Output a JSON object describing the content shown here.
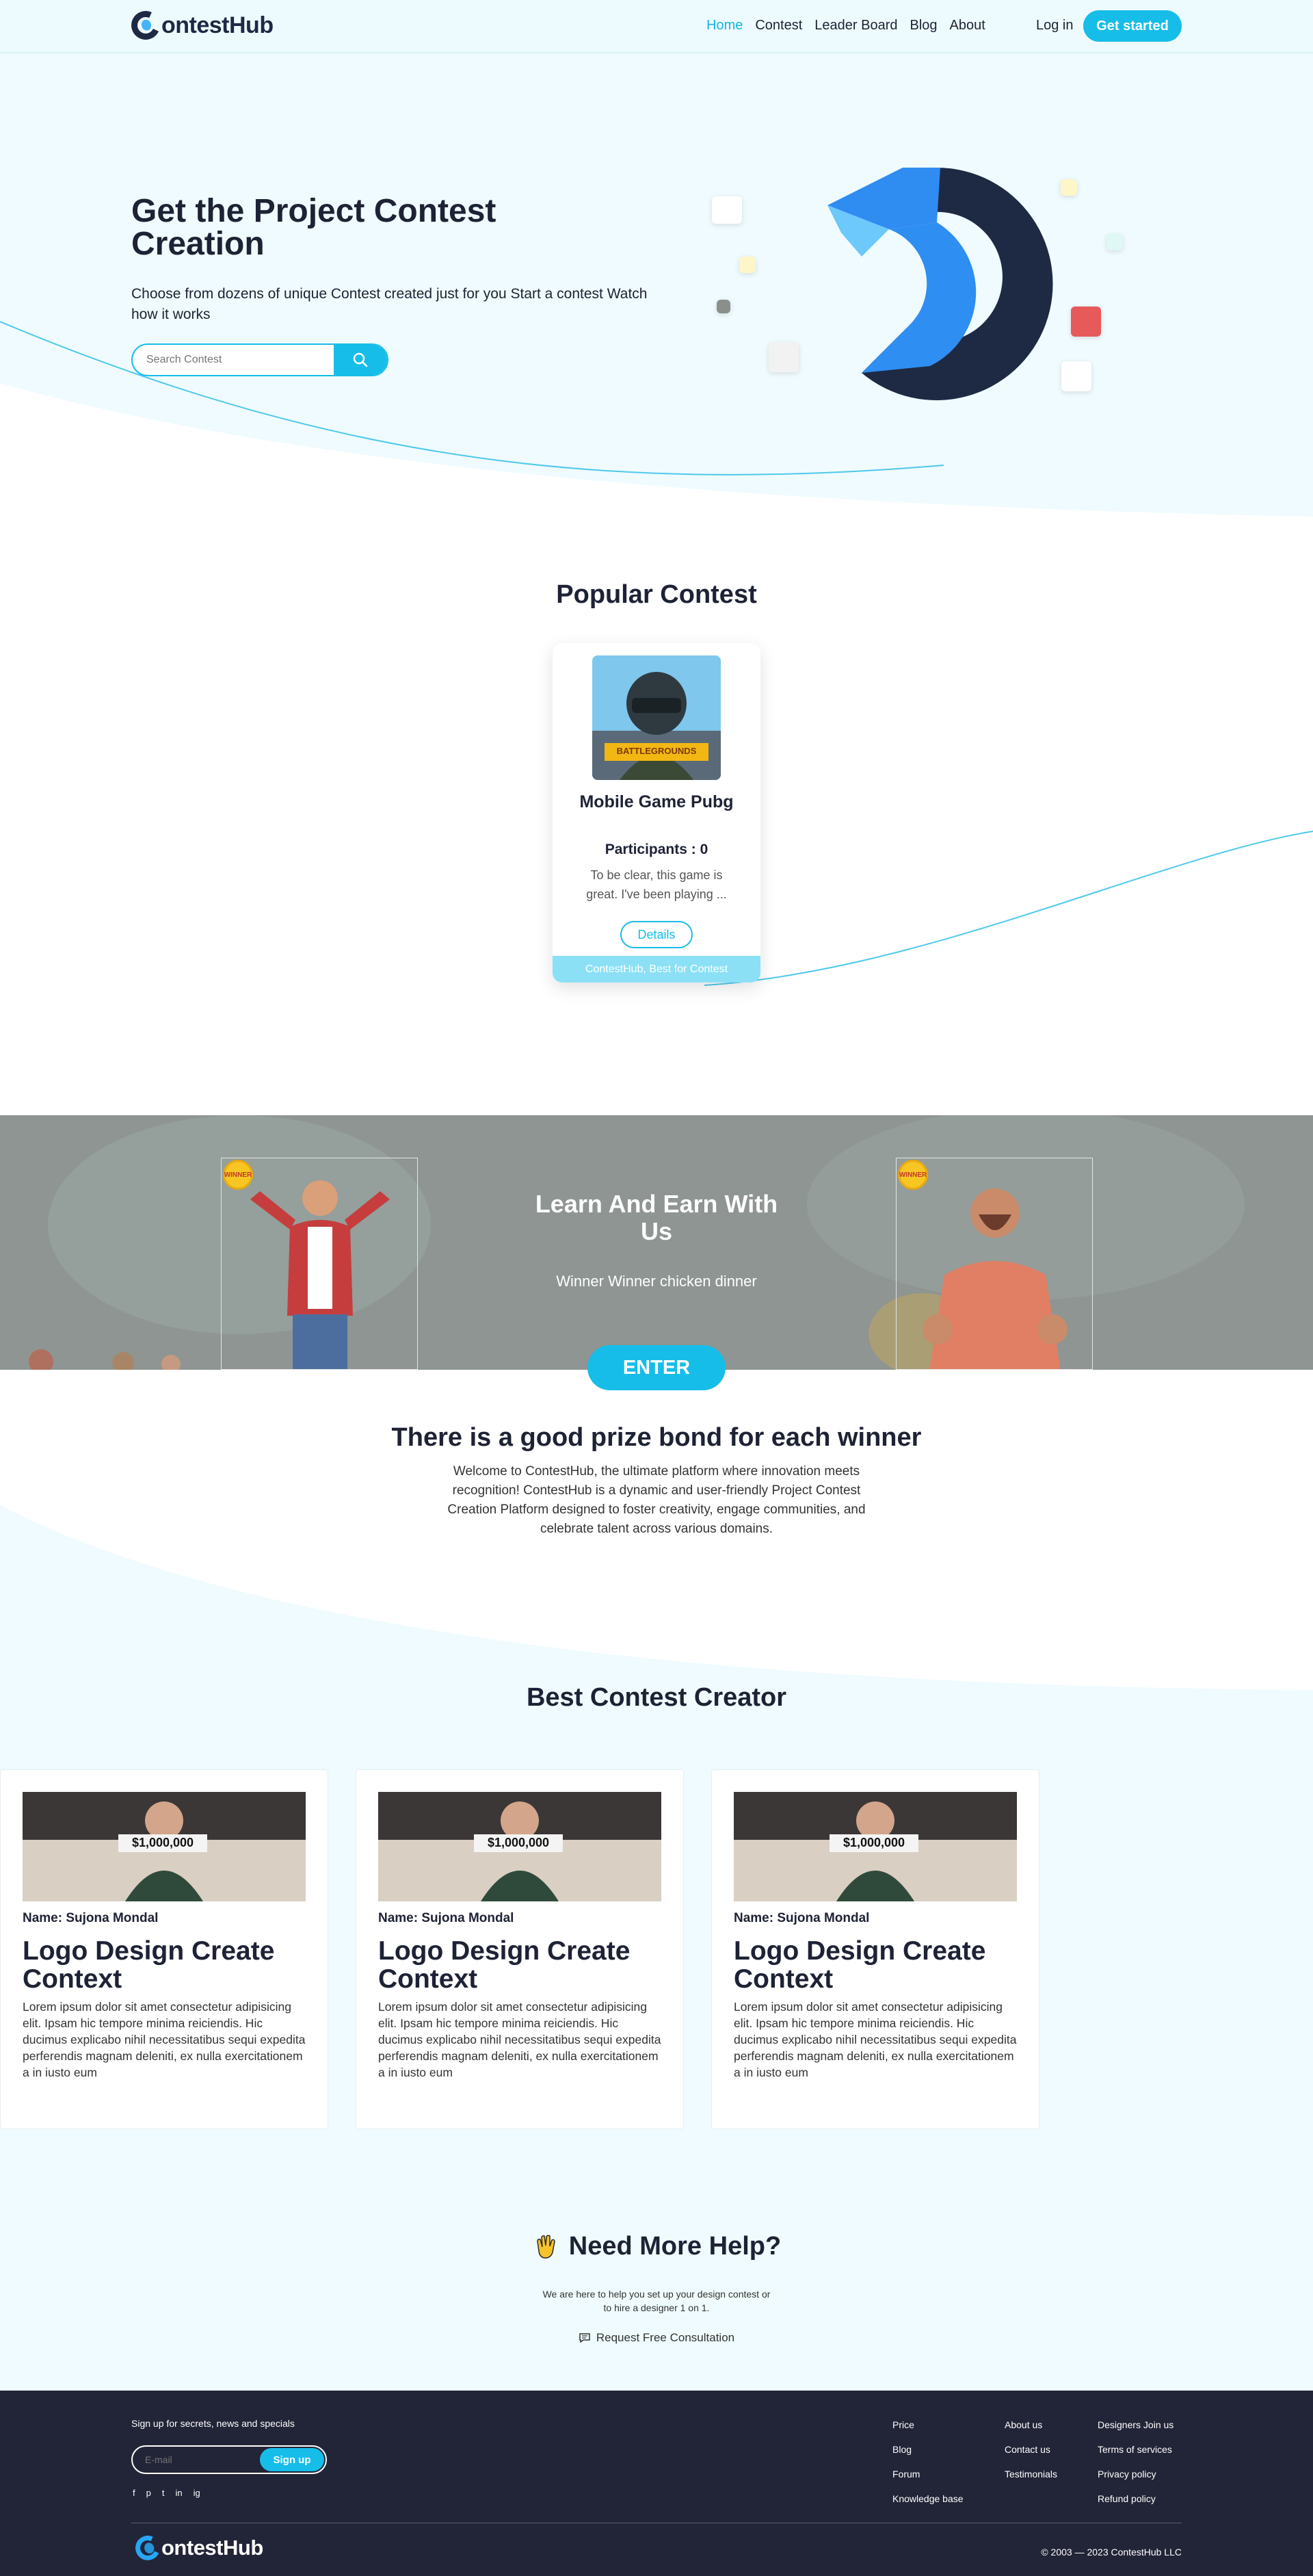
{
  "nav": {
    "logo_text": "ontestHub",
    "links": [
      "Home",
      "Contest",
      "Leader Board",
      "Blog",
      "About"
    ],
    "login": "Log in",
    "get_started": "Get started"
  },
  "hero": {
    "title": "Get the Project Contest Creation",
    "subtitle": "Choose from dozens of unique Contest created just for you Start a contest Watch how it works",
    "search_placeholder": "Search Contest"
  },
  "popular": {
    "title": "Popular Contest",
    "card": {
      "image_text": "BATTLEGROUNDS",
      "name": "Mobile Game Pubg",
      "participants": "Participants : 0",
      "description": "To be clear, this game is great. I've been playing ...",
      "details": "Details",
      "footer": "ContestHub, Best for Contest"
    }
  },
  "learn": {
    "title": "Learn And Earn With Us",
    "subtitle": "Winner Winner chicken dinner",
    "enter": "ENTER",
    "badge": "WINNER"
  },
  "prize": {
    "title": "There is a good prize bond for each winner",
    "text": "Welcome to ContestHub, the ultimate platform where innovation meets recognition! ContestHub is a dynamic and user-friendly Project Contest Creation Platform designed to foster creativity, engage communities, and celebrate talent across various domains."
  },
  "best": {
    "title": "Best Contest Creator",
    "cards": [
      {
        "image_text": "$1,000,000",
        "name": "Name: Sujona Mondal",
        "title": "Logo Design Create Context",
        "description": "Lorem ipsum dolor sit amet consectetur adipisicing elit. Ipsam hic tempore minima reiciendis. Hic ducimus explicabo nihil necessitatibus sequi expedita perferendis magnam deleniti, ex nulla exercitationem a in iusto eum"
      },
      {
        "image_text": "$1,000,000",
        "name": "Name: Sujona Mondal",
        "title": "Logo Design Create Context",
        "description": "Lorem ipsum dolor sit amet consectetur adipisicing elit. Ipsam hic tempore minima reiciendis. Hic ducimus explicabo nihil necessitatibus sequi expedita perferendis magnam deleniti, ex nulla exercitationem a in iusto eum"
      },
      {
        "image_text": "$1,000,000",
        "name": "Name: Sujona Mondal",
        "title": "Logo Design Create Context",
        "description": "Lorem ipsum dolor sit amet consectetur adipisicing elit. Ipsam hic tempore minima reiciendis. Hic ducimus explicabo nihil necessitatibus sequi expedita perferendis magnam deleniti, ex nulla exercitationem a in iusto eum"
      }
    ]
  },
  "help": {
    "title": "Need More Help?",
    "text": "We are here to help you set up your design contest or to hire a designer 1 on 1.",
    "link": "Request Free Consultation"
  },
  "footer": {
    "signup_text": "Sign up for secrets, news and specials",
    "email_placeholder": "E-mail",
    "signup_button": "Sign up",
    "socials": [
      "f",
      "p",
      "t",
      "in",
      "ig"
    ],
    "col1": [
      "Price",
      "Blog",
      "Forum",
      "Knowledge base"
    ],
    "col2": [
      "About us",
      "Contact us",
      "Testimonials"
    ],
    "col3": [
      "Designers Join us",
      "Terms of services",
      "Privacy policy",
      "Refund policy"
    ],
    "logo_text": "ontestHub",
    "copyright": "© 2003 — 2023 ContestHub LLC"
  },
  "colors": {
    "accent": "#16bde9",
    "dark": "#1e2235",
    "footer": "#222437",
    "hero_bg": "#effbfe"
  }
}
